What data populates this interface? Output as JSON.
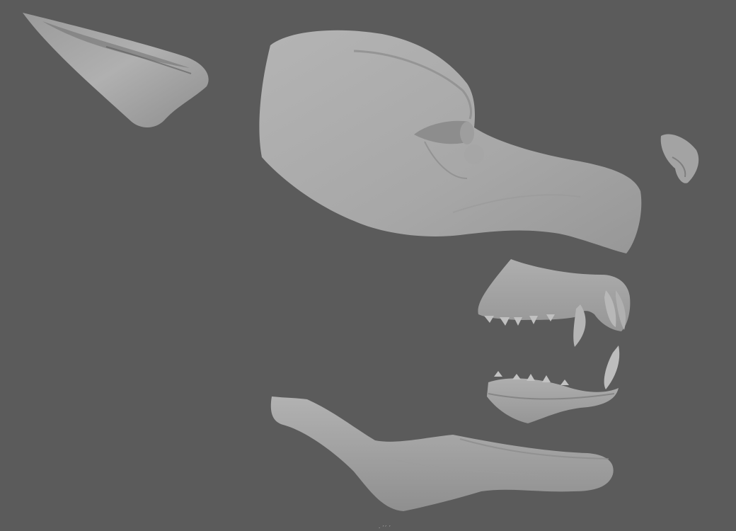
{
  "app": {
    "title": ""
  },
  "viewport": {
    "background": "#5b5b5b",
    "model_color": "#a9a9a9"
  },
  "model_parts": [
    {
      "name": "ear"
    },
    {
      "name": "head-upper"
    },
    {
      "name": "nose-tip"
    },
    {
      "name": "upper-gums-teeth"
    },
    {
      "name": "lower-teeth"
    },
    {
      "name": "lower-jaw"
    }
  ],
  "overlay": {
    "bottom_text": "· ˊˊ ˊ"
  }
}
